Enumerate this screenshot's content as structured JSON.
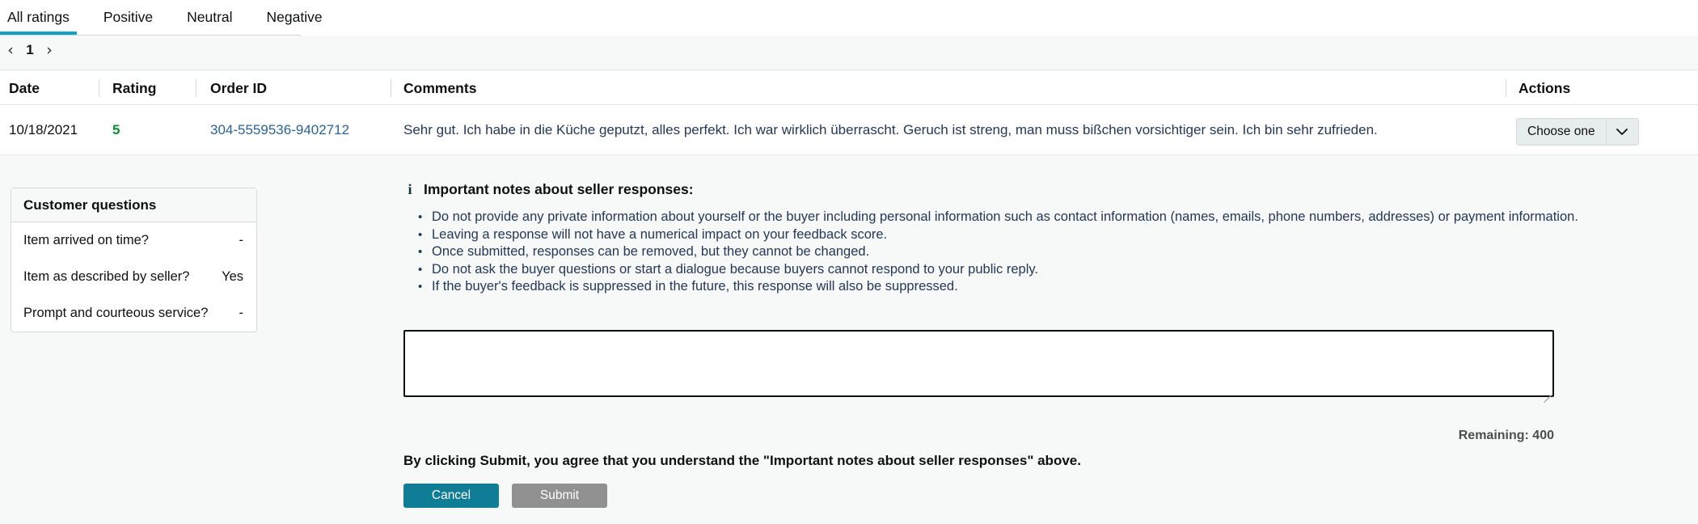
{
  "tabs": [
    {
      "label": "All ratings",
      "active": true
    },
    {
      "label": "Positive",
      "active": false
    },
    {
      "label": "Neutral",
      "active": false
    },
    {
      "label": "Negative",
      "active": false
    }
  ],
  "pagination": {
    "prev_icon": "chevron-left-icon",
    "next_icon": "chevron-right-icon",
    "current_page": "1"
  },
  "table": {
    "columns": [
      "Date",
      "Rating",
      "Order ID",
      "Comments",
      "Actions"
    ],
    "rows": [
      {
        "date": "10/18/2021",
        "rating": "5",
        "order_id": "304-5559536-9402712",
        "comment": "Sehr gut. Ich habe in die Küche geputzt, alles perfekt. Ich war wirklich überrascht. Geruch ist streng, man muss bißchen vorsichtiger sein. Ich bin sehr zufrieden.",
        "action_label": "Choose one",
        "action_caret_icon": "chevron-down-icon"
      }
    ]
  },
  "customer_questions": {
    "title": "Customer questions",
    "items": [
      {
        "question": "Item arrived on time?",
        "answer": "-"
      },
      {
        "question": "Item as described by seller?",
        "answer": "Yes"
      },
      {
        "question": "Prompt and courteous service?",
        "answer": "-"
      }
    ]
  },
  "notes": {
    "icon": "info-icon",
    "heading": "Important notes about seller responses:",
    "bullets": [
      "Do not provide any private information about yourself or the buyer including personal information such as contact information (names, emails, phone numbers, addresses) or payment information.",
      "Leaving a response will not have a numerical impact on your feedback score.",
      "Once submitted, responses can be removed, but they cannot be changed.",
      "Do not ask the buyer questions or start a dialogue because buyers cannot respond to your public reply.",
      "If the buyer's feedback is suppressed in the future, this response will also be suppressed."
    ]
  },
  "reply": {
    "value": "",
    "placeholder": "",
    "remaining_label": "Remaining: 400",
    "agreement": "By clicking Submit, you agree that you understand the \"Important notes about seller responses\" above.",
    "cancel_label": "Cancel",
    "submit_label": "Submit"
  },
  "colors": {
    "tab_accent": "#0fa3c4",
    "link": "#2a6496",
    "rating_positive": "#0b8f2e",
    "cancel_button": "#0e7d95",
    "submit_button_disabled": "#919191",
    "page_background": "#f7f8f8"
  }
}
